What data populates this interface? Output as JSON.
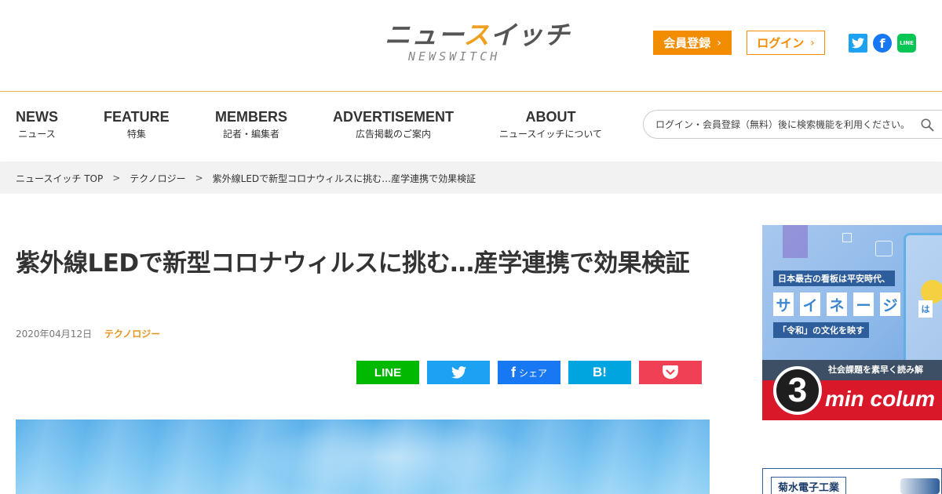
{
  "header": {
    "logo_text_a": "ニュー",
    "logo_text_b": "ス",
    "logo_text_c": "イッチ",
    "logo_sub": "NEWSWITCH",
    "register_label": "会員登録",
    "login_label": "ログイン",
    "chevron": "›",
    "social": [
      {
        "name": "twitter",
        "icon": "twitter-icon",
        "glyph": "t"
      },
      {
        "name": "facebook",
        "icon": "facebook-icon",
        "glyph": "f"
      },
      {
        "name": "line",
        "icon": "line-icon",
        "glyph": "LINE"
      }
    ]
  },
  "nav": {
    "items": [
      {
        "en": "NEWS",
        "ja": "ニュース"
      },
      {
        "en": "FEATURE",
        "ja": "特集"
      },
      {
        "en": "MEMBERS",
        "ja": "記者・編集者"
      },
      {
        "en": "ADVERTISEMENT",
        "ja": "広告掲載のご案内"
      },
      {
        "en": "ABOUT",
        "ja": "ニュースイッチについて"
      }
    ],
    "search_placeholder": "ログイン・会員登録（無料）後に検索機能を利用ください。"
  },
  "breadcrumb": {
    "items": [
      "ニュースイッチ TOP",
      "テクノロジー",
      "紫外線LEDで新型コロナウィルスに挑む…産学連携で効果検証"
    ],
    "separator": ">"
  },
  "article": {
    "title": "紫外線LEDで新型コロナウィルスに挑む…産学連携で効果検証",
    "date": "2020年04月12日",
    "category": "テクノロジー"
  },
  "share": {
    "line": "LINE",
    "facebook_label": "シェア",
    "facebook_glyph": "f",
    "hatena": "B!"
  },
  "ad": {
    "band1": "日本最古の看板は平安時代、",
    "kana": [
      "サ",
      "イ",
      "ネ",
      "ー",
      "ジ"
    ],
    "ha": "は",
    "band2": "「令和」の文化を映す",
    "strip": "社会課題を素早く読み解",
    "number": "3",
    "min_text": "min colum"
  },
  "ad2": {
    "label": "菊水電子工業"
  },
  "colors": {
    "accent": "#f28c00",
    "twitter": "#1da1f2",
    "facebook": "#1877f2",
    "line": "#00b900",
    "hatena": "#00a4de",
    "pocket": "#ef4056"
  }
}
